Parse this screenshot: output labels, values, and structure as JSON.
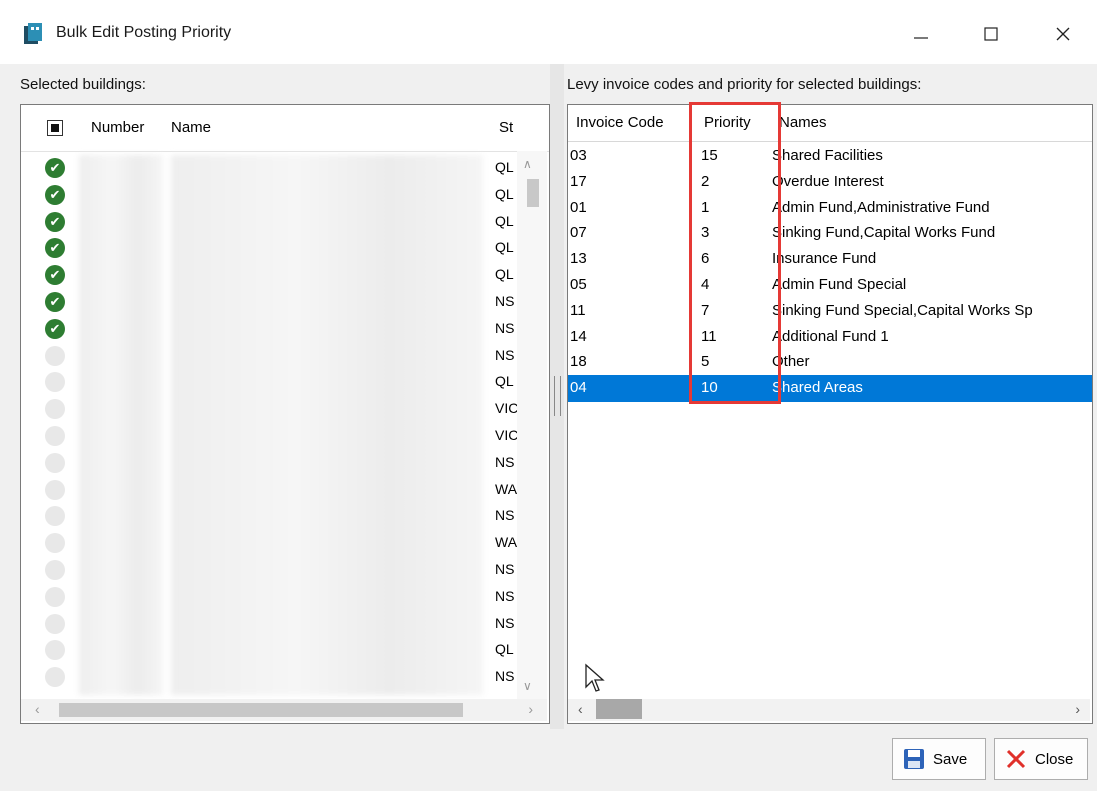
{
  "window": {
    "title": "Bulk Edit Posting Priority"
  },
  "left": {
    "label": "Selected buildings:",
    "columns": [
      "Number",
      "Name",
      "St"
    ],
    "rows": [
      {
        "selected": true,
        "state": "QL"
      },
      {
        "selected": true,
        "state": "QL"
      },
      {
        "selected": true,
        "state": "QL"
      },
      {
        "selected": true,
        "state": "QL"
      },
      {
        "selected": true,
        "state": "QL"
      },
      {
        "selected": true,
        "state": "NS"
      },
      {
        "selected": true,
        "state": "NS"
      },
      {
        "selected": false,
        "state": "NS"
      },
      {
        "selected": false,
        "state": "QL"
      },
      {
        "selected": false,
        "state": "VIC"
      },
      {
        "selected": false,
        "state": "VIC"
      },
      {
        "selected": false,
        "state": "NS"
      },
      {
        "selected": false,
        "state": "WA"
      },
      {
        "selected": false,
        "state": "NS"
      },
      {
        "selected": false,
        "state": "WA"
      },
      {
        "selected": false,
        "state": "NS"
      },
      {
        "selected": false,
        "state": "NS"
      },
      {
        "selected": false,
        "state": "NS"
      },
      {
        "selected": false,
        "state": "QL"
      },
      {
        "selected": false,
        "state": "NS"
      }
    ]
  },
  "right": {
    "label": "Levy invoice codes and priority for selected buildings:",
    "columns": [
      "Invoice Code",
      "Priority",
      "Names"
    ],
    "rows": [
      {
        "code": "03",
        "priority": "15",
        "names": "Shared Facilities"
      },
      {
        "code": "17",
        "priority": "2",
        "names": "Overdue Interest"
      },
      {
        "code": "01",
        "priority": "1",
        "names": "Admin Fund,Administrative Fund"
      },
      {
        "code": "07",
        "priority": "3",
        "names": "Sinking Fund,Capital Works Fund"
      },
      {
        "code": "13",
        "priority": "6",
        "names": "Insurance Fund"
      },
      {
        "code": "05",
        "priority": "4",
        "names": "Admin Fund Special"
      },
      {
        "code": "11",
        "priority": "7",
        "names": "Sinking Fund Special,Capital Works Sp"
      },
      {
        "code": "14",
        "priority": "11",
        "names": "Additional Fund 1"
      },
      {
        "code": "18",
        "priority": "5",
        "names": "Other"
      },
      {
        "code": "04",
        "priority": "10",
        "names": "Shared Areas",
        "selected": true
      }
    ]
  },
  "buttons": {
    "save": "Save",
    "close": "Close"
  },
  "colors": {
    "selection": "#0078d7",
    "highlight": "#e53935",
    "check": "#2e7d32"
  }
}
